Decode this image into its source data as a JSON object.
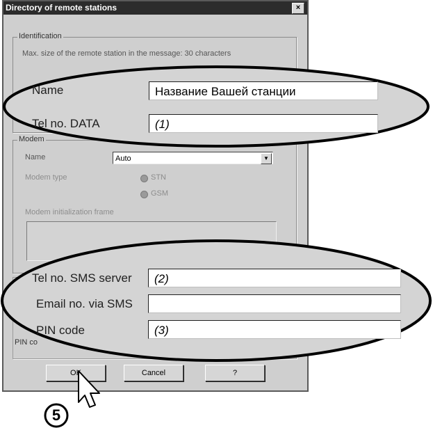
{
  "dialog": {
    "title": "Directory of remote stations",
    "close_glyph": "×"
  },
  "identification": {
    "legend": "Identification",
    "max_size_text": "Max. size of the remote station in the message: 30 characters"
  },
  "modem": {
    "legend": "Modem",
    "name_label": "Name",
    "name_value": "Auto",
    "modem_type_label": "Modem type",
    "radio_options": [
      "STN",
      "GSM"
    ],
    "init_frame_label": "Modem initialization frame"
  },
  "callout_top": {
    "name_label": "Name",
    "name_value": "Название Вашей станции",
    "tel_data_label": "Tel no. DATA",
    "tel_data_value": "(1)"
  },
  "callout_bottom": {
    "sms_server_label": "Tel no. SMS server",
    "sms_server_value": "(2)",
    "email_sms_label": "Email no. via SMS",
    "email_sms_value": "",
    "pin_label": "PIN code",
    "pin_value": "(3)",
    "pin_underlying_label": "PIN co"
  },
  "buttons": {
    "ok": "OK",
    "cancel": "Cancel",
    "help": "?"
  },
  "step_number": "5",
  "icons": {
    "close": "close-icon",
    "dropdown": "chevron-down-icon",
    "pointer": "mouse-pointer-icon"
  },
  "colors": {
    "titlebar": "#2c2c2c",
    "dialog_bg": "#cfcfcf",
    "callout_fill": "#d4d4d4"
  }
}
